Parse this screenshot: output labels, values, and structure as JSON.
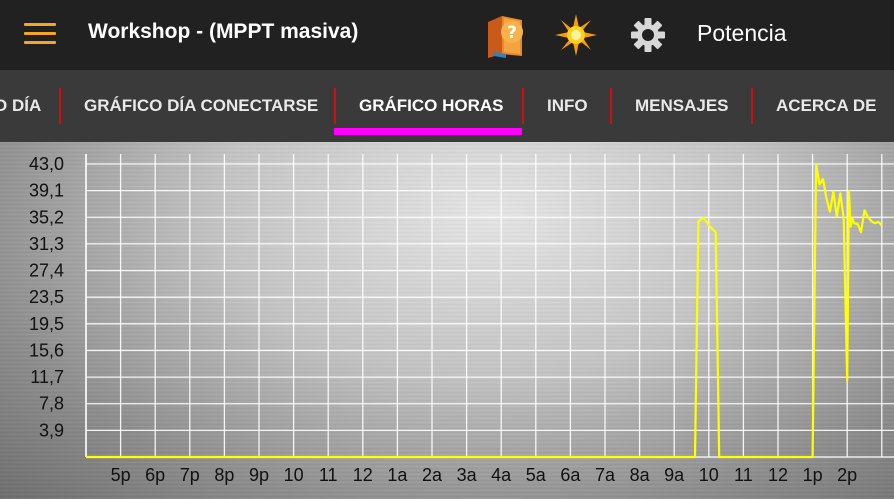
{
  "appbar": {
    "title": "Workshop - (MPPT masiva)",
    "right_label": "Potencia",
    "actions": [
      "help-book-icon",
      "sun-icon",
      "gear-icon"
    ],
    "accent_color": "#f5a623"
  },
  "tabs": [
    {
      "label": "O DÍA"
    },
    {
      "label": "GRÁFICO DÍA CONECTARSE"
    },
    {
      "label": "GRÁFICO HORAS",
      "selected": true
    },
    {
      "label": "INFO"
    },
    {
      "label": "MENSAJES"
    },
    {
      "label": "ACERCA DE"
    }
  ],
  "tab_indicator_color": "#ff00ff",
  "chart_data": {
    "type": "line",
    "line_color": "#ffff00",
    "grid": true,
    "ylim": [
      0,
      43.0
    ],
    "yticks": [
      "43,0",
      "39,1",
      "35,2",
      "31,3",
      "27,4",
      "23,5",
      "19,5",
      "15,6",
      "11,7",
      "7,8",
      "3,9"
    ],
    "xticks": [
      "5p",
      "6p",
      "7p",
      "8p",
      "9p",
      "10",
      "11",
      "12",
      "1a",
      "2a",
      "3a",
      "4a",
      "5a",
      "6a",
      "7a",
      "8a",
      "9a",
      "10",
      "11",
      "12",
      "1p",
      "2p"
    ],
    "x_unit": "hour index from 4p",
    "series": [
      {
        "x": [
          0,
          17.6,
          17.7,
          17.85,
          18.0,
          18.2,
          18.3,
          18.35,
          21.0,
          21.1,
          21.2,
          21.3,
          21.4,
          21.5,
          21.6,
          21.7,
          21.8,
          21.9,
          22.0,
          22.05,
          22.1,
          22.15,
          22.2,
          22.3,
          22.4,
          22.5,
          22.6,
          22.7,
          22.8,
          22.9,
          23.0
        ],
        "y": [
          0,
          0,
          34.6,
          35.1,
          34.0,
          33.0,
          0,
          0,
          0,
          43.0,
          40.0,
          40.8,
          38.0,
          36.0,
          39.0,
          35.2,
          38.7,
          35.0,
          11.2,
          39.0,
          33.8,
          35.0,
          34.3,
          34.2,
          33.0,
          36.2,
          35.2,
          34.6,
          34.3,
          34.5,
          34.0
        ]
      }
    ]
  }
}
